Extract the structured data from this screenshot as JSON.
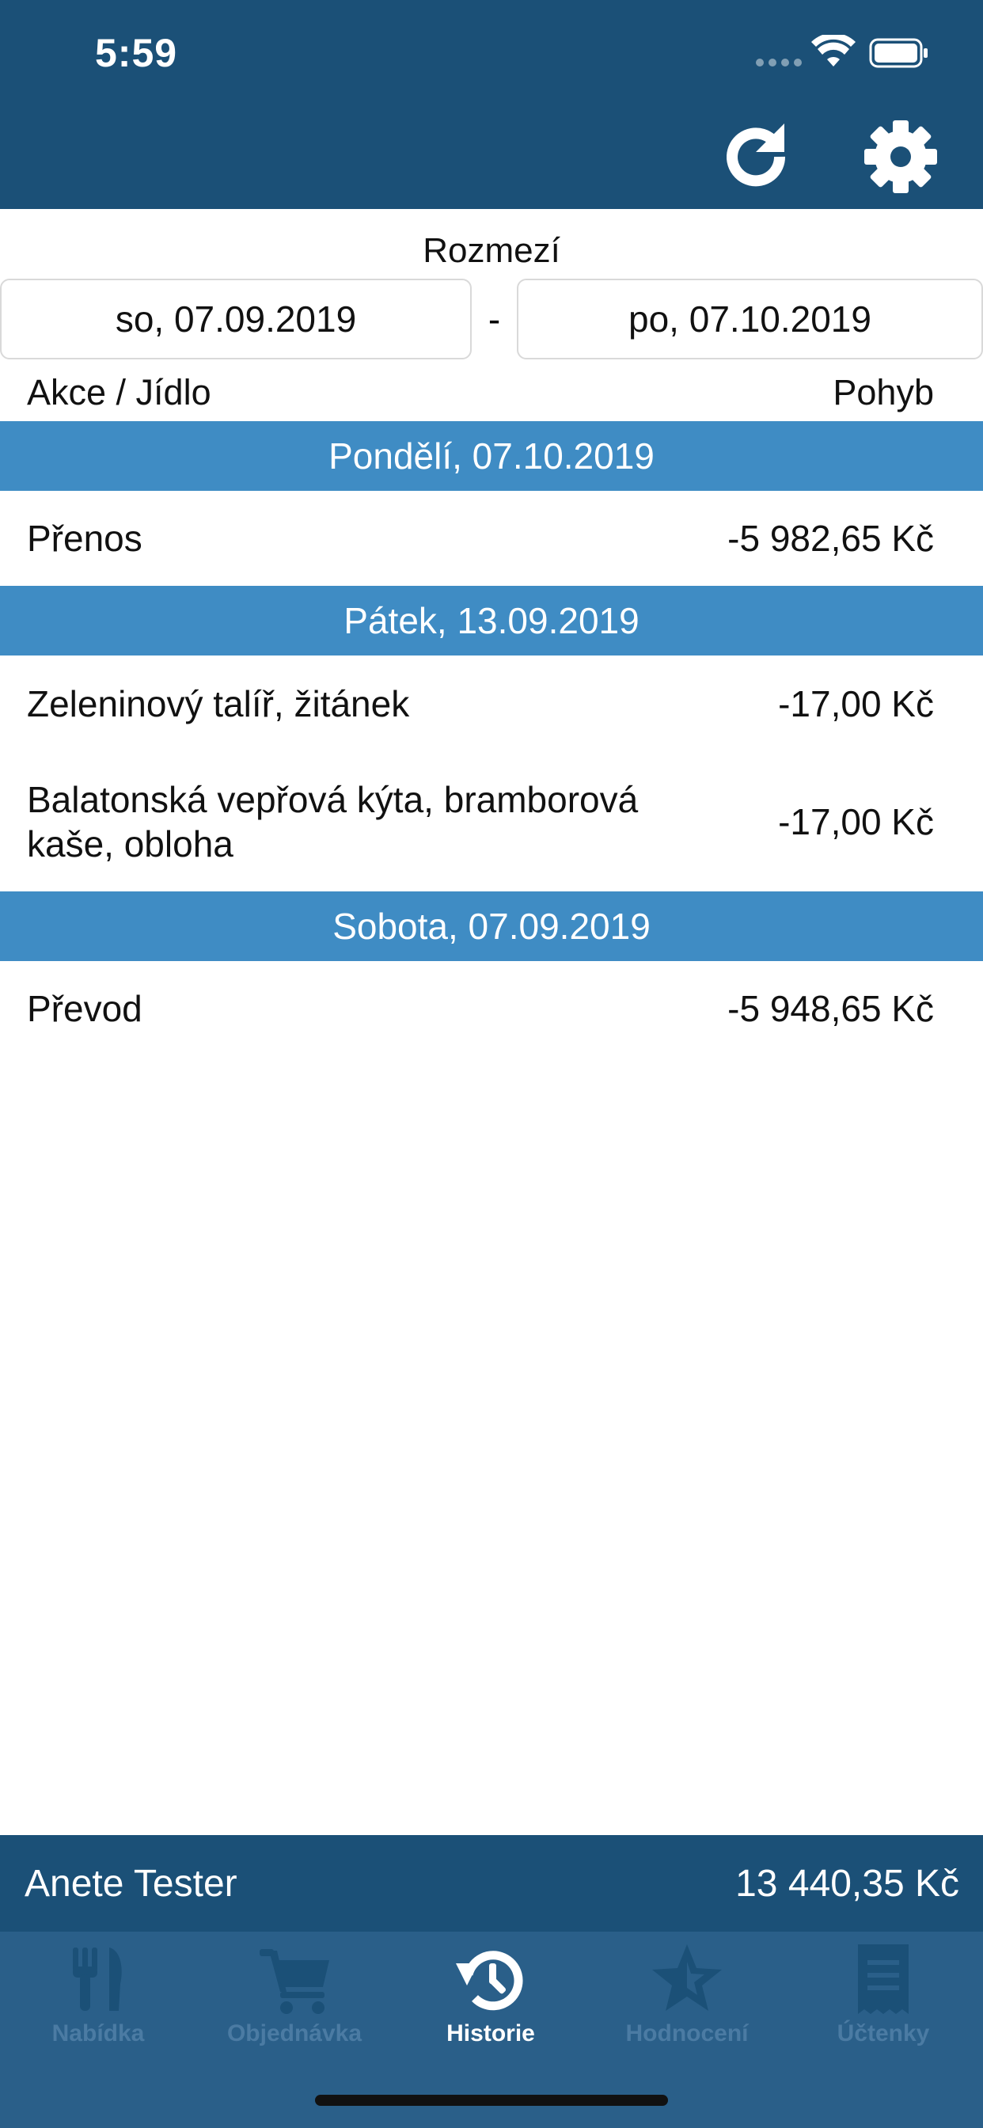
{
  "status_bar": {
    "time": "5:59"
  },
  "range": {
    "label": "Rozmezí",
    "from": "so, 07.09.2019",
    "separator": "-",
    "to": "po, 07.10.2019"
  },
  "columns": {
    "left": "Akce / Jídlo",
    "right": "Pohyb"
  },
  "days": [
    {
      "header": "Pondělí, 07.10.2019",
      "rows": [
        {
          "name": "Přenos",
          "amount": "-5 982,65 Kč"
        }
      ]
    },
    {
      "header": "Pátek, 13.09.2019",
      "rows": [
        {
          "name": "Zeleninový talíř, žitánek",
          "amount": "-17,00 Kč"
        },
        {
          "name": "Balatonská vepřová kýta, bramborová kaše, obloha",
          "amount": "-17,00 Kč"
        }
      ]
    },
    {
      "header": "Sobota, 07.09.2019",
      "rows": [
        {
          "name": "Převod",
          "amount": "-5 948,65 Kč"
        }
      ]
    }
  ],
  "footer": {
    "user": "Anete Tester",
    "balance": "13 440,35 Kč"
  },
  "tabs": [
    {
      "label": "Nabídka",
      "icon": "fork-knife-icon",
      "active": false
    },
    {
      "label": "Objednávka",
      "icon": "cart-icon",
      "active": false
    },
    {
      "label": "Historie",
      "icon": "history-icon",
      "active": true
    },
    {
      "label": "Hodnocení",
      "icon": "star-icon",
      "active": false
    },
    {
      "label": "Účtenky",
      "icon": "receipt-icon",
      "active": false
    }
  ],
  "colors": {
    "header": "#1b5077",
    "day_header": "#3f8cc4",
    "tab_bar": "#2a5f89",
    "tab_inactive": "#4b7ba3"
  }
}
